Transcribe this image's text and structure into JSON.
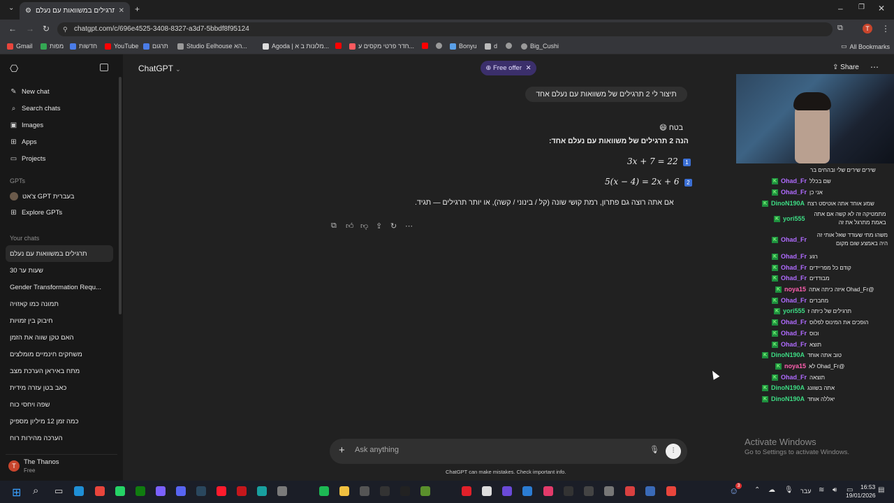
{
  "browser": {
    "tab_title": "תרגילים במשוואות עם נעלם",
    "url": "chatgpt.com/c/696e4525-3408-8327-a3d7-5bbdf8f95124",
    "bookmarks": [
      "Gmail",
      "מפות",
      "חדשות",
      "YouTube",
      "תרגום",
      "Studio Eelhouse הא...",
      "Agoda | מלונות ב א...",
      "חדר פרטי מקסים ע...",
      "Bonyu",
      "d",
      "Big_Cushi"
    ],
    "all_bookmarks": "All Bookmarks"
  },
  "sidebar": {
    "menu": [
      "New chat",
      "Search chats",
      "Images",
      "Apps",
      "Projects"
    ],
    "gpts_label": "GPTs",
    "gpts": [
      "צ'אט GPT בעברית",
      "Explore GPTs"
    ],
    "your_chats_label": "Your chats",
    "chats": [
      "תרגילים במשוואות עם נעלם",
      "30 שעות ער",
      "Gender Transformation Requ...",
      "תמונה כמו קאזויה",
      "חיבוק בין זמויות",
      "האם טקן שווה את הזמן",
      "משחקים חינמיים מומלצים",
      "מתח באיראן הערכת מצב",
      "כאב בטן עזרה מידית",
      "שפה ויחסי כוח",
      "כמה זמן 12 מיליון מספיק",
      "הערכה מהירות רוח"
    ],
    "user": {
      "name": "The Thanos",
      "plan": "Free",
      "initial": "T"
    }
  },
  "header": {
    "model": "ChatGPT",
    "free_offer": "Free offer",
    "share": "Share"
  },
  "conversation": {
    "user_message": "תיצור לי 2 תרגילים של משוואות עם נעלם אחד",
    "reply_line1": "בטח 😄",
    "reply_line2": "הנה 2 תרגילים של משוואות עם נעלם אחד:",
    "eq1": "3x + 7 = 22",
    "eq2": "5(x − 4) = 2x + 6",
    "eq1_num": "1",
    "eq2_num": "2",
    "reply_line3": "אם אתה רוצה גם פתרון, רמת קושי שונה (קל / בינוני / קשה), או יותר תרגילים — תגיד."
  },
  "composer": {
    "placeholder": "Ask anything",
    "disclaimer": "ChatGPT can make mistakes. Check important info."
  },
  "overlay_chat": [
    {
      "user": "",
      "msg": "שירים שירים שלי ובהחים בר",
      "color": "#e8e8e8"
    },
    {
      "user": "Ohad_Fr",
      "msg": "שם בכלל",
      "color": "#b06bff"
    },
    {
      "user": "Ohad_Fr",
      "msg": "אני כן",
      "color": "#b06bff"
    },
    {
      "user": "DinoN190A",
      "msg": "שמע אוחד אתה אוטיסט רצח",
      "color": "#3ddc84"
    },
    {
      "user": "yori555",
      "msg": "מתמטיקה זה לא קשה אם אתה באמת מתרגל את זה",
      "color": "#3ddc84"
    },
    {
      "user": "Ohad_Fr",
      "msg": "משהו מתי שעודד שאל אותי זה היה באמצע שום מקום",
      "color": "#b06bff"
    },
    {
      "user": "Ohad_Fr",
      "msg": "רגע",
      "color": "#b06bff"
    },
    {
      "user": "Ohad_Fr",
      "msg": "קודם כל מפריידים",
      "color": "#b06bff"
    },
    {
      "user": "Ohad_Fr",
      "msg": "מבודדים",
      "color": "#b06bff"
    },
    {
      "user": "noya15",
      "msg": "@Ohad_Fr איזה כיתה אתה",
      "color": "#ff5fb0"
    },
    {
      "user": "Ohad_Fr",
      "msg": "מחברים",
      "color": "#b06bff"
    },
    {
      "user": "yori555",
      "msg": "תרגילים של כיתה ז",
      "color": "#3ddc84"
    },
    {
      "user": "Ohad_Fr",
      "msg": "הופכים את המינוס לפלוס",
      "color": "#b06bff"
    },
    {
      "user": "Ohad_Fr",
      "msg": "וכוס",
      "color": "#b06bff"
    },
    {
      "user": "Ohad_Fr",
      "msg": "תוצא",
      "color": "#b06bff"
    },
    {
      "user": "DinoN190A",
      "msg": "טוב אתה אוחד",
      "color": "#3ddc84"
    },
    {
      "user": "noya15",
      "msg": "@Ohad_Fr לא",
      "color": "#ff5fb0"
    },
    {
      "user": "Ohad_Fr",
      "msg": "תוצאה",
      "color": "#b06bff"
    },
    {
      "user": "DinoN190A",
      "msg": "אתה בשוונג",
      "color": "#3ddc84"
    },
    {
      "user": "DinoN190A",
      "msg": "יאללה אוחד",
      "color": "#3ddc84"
    }
  ],
  "watermark": {
    "title": "Activate Windows",
    "subtitle": "Go to Settings to activate Windows."
  },
  "taskbar": {
    "lang": "עבר",
    "time": "16:53",
    "date": "19/01/2026",
    "notif_count": "3"
  }
}
